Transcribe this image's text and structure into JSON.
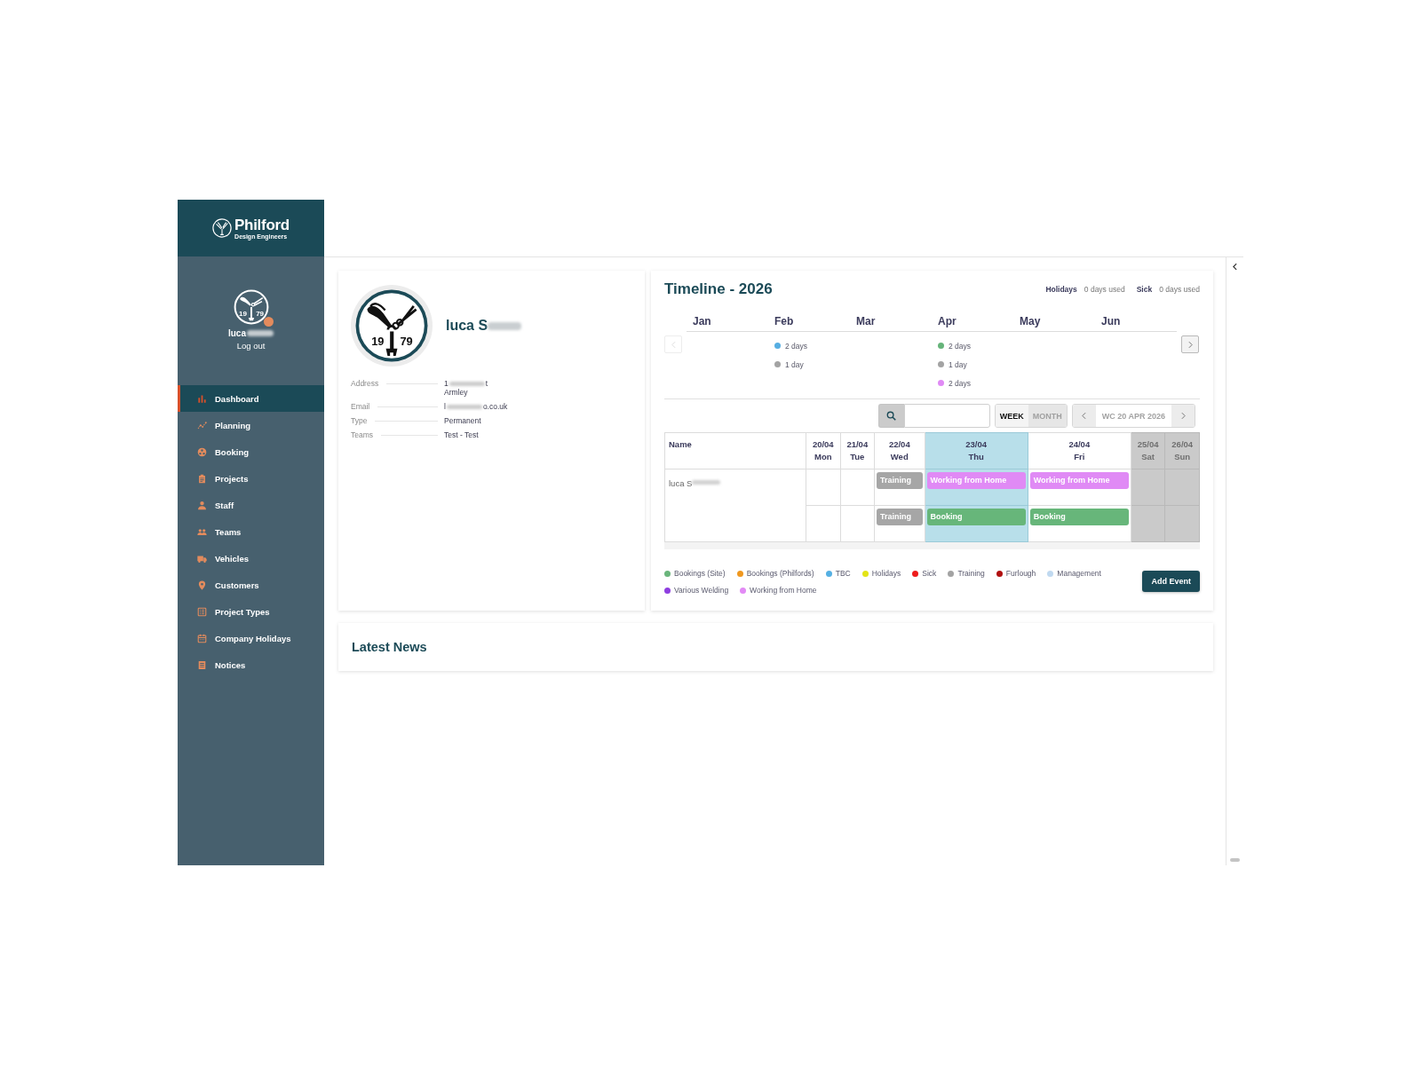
{
  "brand": {
    "name": "Philford",
    "tagline": "Design Engineers"
  },
  "user_panel": {
    "logo_years": [
      "19",
      "79"
    ],
    "name": "luca",
    "name_redacted": true,
    "logout": "Log out"
  },
  "nav": [
    {
      "label": "Dashboard",
      "selected": true
    },
    {
      "label": "Planning",
      "selected": false
    },
    {
      "label": "Booking",
      "selected": false
    },
    {
      "label": "Projects",
      "selected": false
    },
    {
      "label": "Staff",
      "selected": false
    },
    {
      "label": "Teams",
      "selected": false
    },
    {
      "label": "Vehicles",
      "selected": false
    },
    {
      "label": "Customers",
      "selected": false
    },
    {
      "label": "Project Types",
      "selected": false
    },
    {
      "label": "Company Holidays",
      "selected": false
    },
    {
      "label": "Notices",
      "selected": false
    }
  ],
  "profile": {
    "logo_years": [
      "19",
      "79"
    ],
    "name": "luca S",
    "name_redacted": true,
    "details": [
      {
        "label": "Address",
        "lines": [
          {
            "start": "1",
            "end": "t",
            "redacted": true
          },
          {
            "start": "Armley"
          }
        ]
      },
      {
        "label": "Email",
        "lines": [
          {
            "start": "l",
            "end": "o.co.uk",
            "redacted": true
          }
        ]
      },
      {
        "label": "Type",
        "lines": [
          {
            "start": "Permanent"
          }
        ]
      },
      {
        "label": "Teams",
        "lines": [
          {
            "start": "Test - Test"
          }
        ]
      }
    ]
  },
  "timeline": {
    "title": "Timeline - 2026",
    "summary": [
      {
        "label": "Holidays",
        "value": "0 days used"
      },
      {
        "label": "Sick",
        "value": "0 days used"
      }
    ],
    "prev_button": {
      "disabled": true
    },
    "next_button": {
      "disabled": false
    },
    "months": [
      {
        "label": "Jan"
      },
      {
        "label": "Feb",
        "entries": [
          {
            "text": "2 days",
            "color": "#56aee2"
          },
          {
            "text": "1 day",
            "color": "#a3a3a3"
          }
        ]
      },
      {
        "label": "Mar"
      },
      {
        "label": "Apr",
        "entries": [
          {
            "text": "2 days",
            "color": "#66b47a"
          },
          {
            "text": "1 day",
            "color": "#a3a3a3"
          },
          {
            "text": "2 days",
            "color": "#e08af5"
          }
        ]
      },
      {
        "label": "May"
      },
      {
        "label": "Jun"
      }
    ],
    "view_modes": [
      {
        "label": "WEEK",
        "selected": true
      },
      {
        "label": "MONTH",
        "selected": false
      }
    ],
    "week_label": "WC 20 APR 2026",
    "table": {
      "name_header": "Name",
      "days": [
        {
          "date": "20/04",
          "day": "Mon",
          "today": false,
          "weekend": false
        },
        {
          "date": "21/04",
          "day": "Tue",
          "today": false,
          "weekend": false
        },
        {
          "date": "22/04",
          "day": "Wed",
          "today": false,
          "weekend": false
        },
        {
          "date": "23/04",
          "day": "Thu",
          "today": true,
          "weekend": false
        },
        {
          "date": "24/04",
          "day": "Fri",
          "today": false,
          "weekend": false
        },
        {
          "date": "25/04",
          "day": "Sat",
          "today": false,
          "weekend": true
        },
        {
          "date": "26/04",
          "day": "Sun",
          "today": false,
          "weekend": true
        }
      ],
      "rows": [
        {
          "name": "luca S",
          "redacted": true,
          "lanes": [
            {
              "cells": [
                {
                  "kind": "empty"
                },
                {
                  "kind": "empty"
                },
                {
                  "kind": "event",
                  "label": "Training",
                  "color": "#a6a6a6"
                },
                {
                  "kind": "event",
                  "label": "Working from Home",
                  "color": "#e08af5"
                },
                {
                  "kind": "event",
                  "label": "Working from Home",
                  "color": "#e08af5"
                },
                {
                  "kind": "empty"
                },
                {
                  "kind": "empty"
                }
              ]
            },
            {
              "cells": [
                {
                  "kind": "empty"
                },
                {
                  "kind": "empty"
                },
                {
                  "kind": "event",
                  "label": "Training",
                  "color": "#a6a6a6"
                },
                {
                  "kind": "event",
                  "label": "Booking",
                  "color": "#67b67a"
                },
                {
                  "kind": "event",
                  "label": "Booking",
                  "color": "#67b67a"
                },
                {
                  "kind": "empty"
                },
                {
                  "kind": "empty"
                }
              ]
            }
          ]
        }
      ]
    },
    "legend": [
      {
        "label": "Bookings (Site)",
        "color": "#6ab57b"
      },
      {
        "label": "Bookings (Philfords)",
        "color": "#f0981f"
      },
      {
        "label": "TBC",
        "color": "#55b0e3"
      },
      {
        "label": "Holidays",
        "color": "#e3e417"
      },
      {
        "label": "Sick",
        "color": "#ee1c1c"
      },
      {
        "label": "Training",
        "color": "#a3a3a3"
      },
      {
        "label": "Furlough",
        "color": "#b01010"
      },
      {
        "label": "Management",
        "color": "#c0d9f0"
      },
      {
        "label": "Various Welding",
        "color": "#8e3ee0"
      },
      {
        "label": "Working from Home",
        "color": "#e28af5"
      }
    ],
    "add_event": "Add Event"
  },
  "news": {
    "title": "Latest News"
  }
}
